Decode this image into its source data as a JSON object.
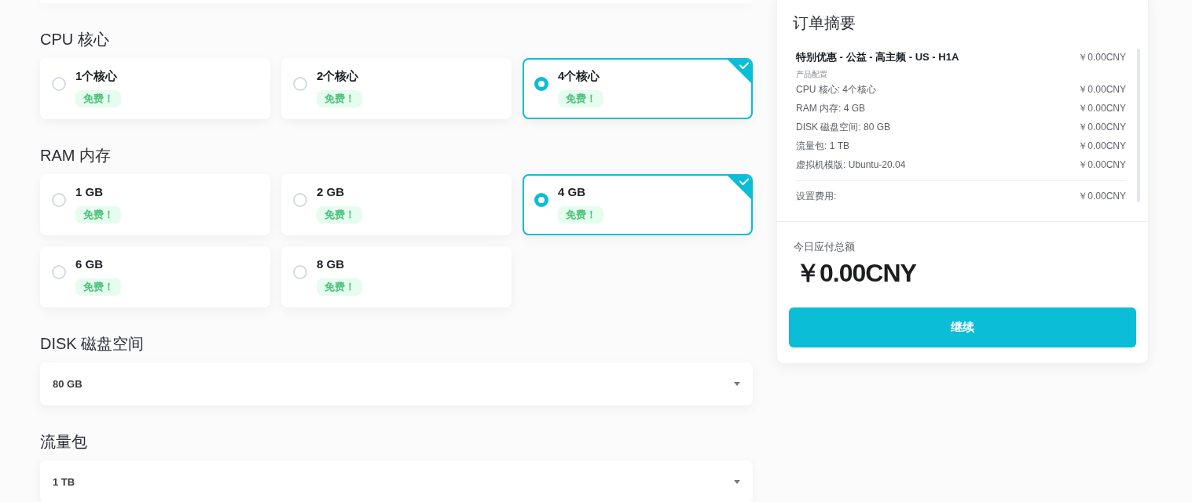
{
  "sections": [
    {
      "kind": "options",
      "title": "CPU 核心",
      "options": [
        {
          "label": "1个核心",
          "badge": "免费！",
          "selected": false
        },
        {
          "label": "2个核心",
          "badge": "免费！",
          "selected": false
        },
        {
          "label": "4个核心",
          "badge": "免费！",
          "selected": true
        }
      ]
    },
    {
      "kind": "options",
      "title": "RAM 内存",
      "options": [
        {
          "label": "1 GB",
          "badge": "免费！",
          "selected": false
        },
        {
          "label": "2 GB",
          "badge": "免费！",
          "selected": false
        },
        {
          "label": "4 GB",
          "badge": "免费！",
          "selected": true
        },
        {
          "label": "6 GB",
          "badge": "免费！",
          "selected": false
        },
        {
          "label": "8 GB",
          "badge": "免费！",
          "selected": false
        }
      ]
    },
    {
      "kind": "dropdown",
      "title": "DISK 磁盘空间",
      "value": "80 GB"
    },
    {
      "kind": "dropdown",
      "title": "流量包",
      "value": "1 TB"
    }
  ],
  "summary": {
    "title": "订单摘要",
    "product": {
      "name": "特别优惠 - 公益 - 高主频 - US - H1A",
      "price": "￥0.00CNY"
    },
    "config_label": "产品配置",
    "items": [
      {
        "label": "CPU 核心: 4个核心",
        "price": "￥0.00CNY"
      },
      {
        "label": "RAM 内存: 4 GB",
        "price": "￥0.00CNY"
      },
      {
        "label": "DISK 磁盘空间: 80 GB",
        "price": "￥0.00CNY"
      },
      {
        "label": "流量包: 1 TB",
        "price": "￥0.00CNY"
      },
      {
        "label": "虚拟机模版: Ubuntu-20.04",
        "price": "￥0.00CNY"
      }
    ],
    "setup": {
      "label": "设置费用:",
      "price": "￥0.00CNY"
    },
    "total_label": "今日应付总额",
    "total": "￥0.00CNY",
    "button": "继续"
  }
}
